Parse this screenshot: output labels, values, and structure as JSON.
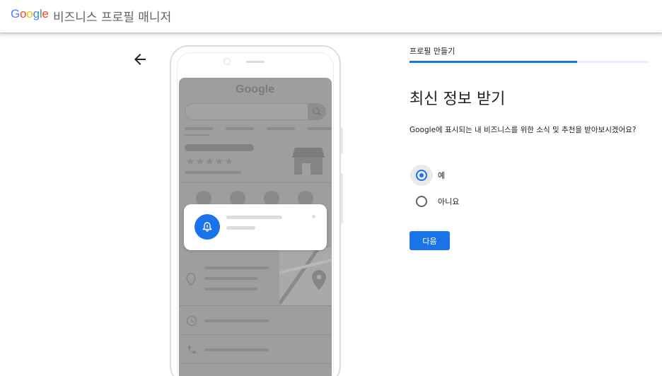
{
  "header": {
    "logo_text": "Google",
    "product_name": "비즈니스 프로필 매니저"
  },
  "nav": {
    "back_icon": "arrow-back-icon"
  },
  "preview": {
    "screen_brand": "Google",
    "rating_stars": "★★★★★",
    "notification_icon": "bell-icon"
  },
  "form": {
    "step_label": "프로필 만들기",
    "progress": 0.7,
    "title": "최신 정보 받기",
    "description": "Google에 표시되는 내 비즈니스를 위한 소식 및 추천을 받아보시겠어요?",
    "options": [
      {
        "label": "예",
        "selected": true
      },
      {
        "label": "아니요",
        "selected": false
      }
    ],
    "next_label": "다음"
  },
  "colors": {
    "accent": "#1a73e8",
    "text": "#202124",
    "muted": "#5f6368",
    "preview_gray": "#9e9e9e"
  }
}
